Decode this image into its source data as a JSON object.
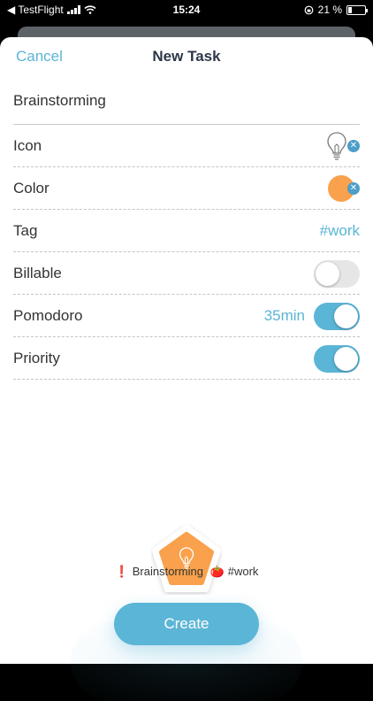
{
  "status_bar": {
    "carrier": "◀ TestFlight",
    "time": "15:24",
    "battery_text": "21 %",
    "battery_level": 0.21
  },
  "nav": {
    "cancel_label": "Cancel",
    "title": "New Task"
  },
  "task_name": {
    "value": "Brainstorming"
  },
  "rows": {
    "icon": {
      "label": "Icon",
      "icon": "lightbulb-icon"
    },
    "color": {
      "label": "Color",
      "value": "#f9a14c"
    },
    "tag": {
      "label": "Tag",
      "value": "#work"
    },
    "billable": {
      "label": "Billable",
      "enabled": false
    },
    "pomodoro": {
      "label": "Pomodoro",
      "value": "35min",
      "enabled": true
    },
    "priority": {
      "label": "Priority",
      "enabled": true
    }
  },
  "preview": {
    "priority_mark": "❗",
    "name": "Brainstorming",
    "pomodoro_mark": "🍅",
    "tag": "#work"
  },
  "create_label": "Create",
  "colors": {
    "accent": "#5bb5d6",
    "task_color": "#f9a14c",
    "clear": "#4c9ec8"
  }
}
